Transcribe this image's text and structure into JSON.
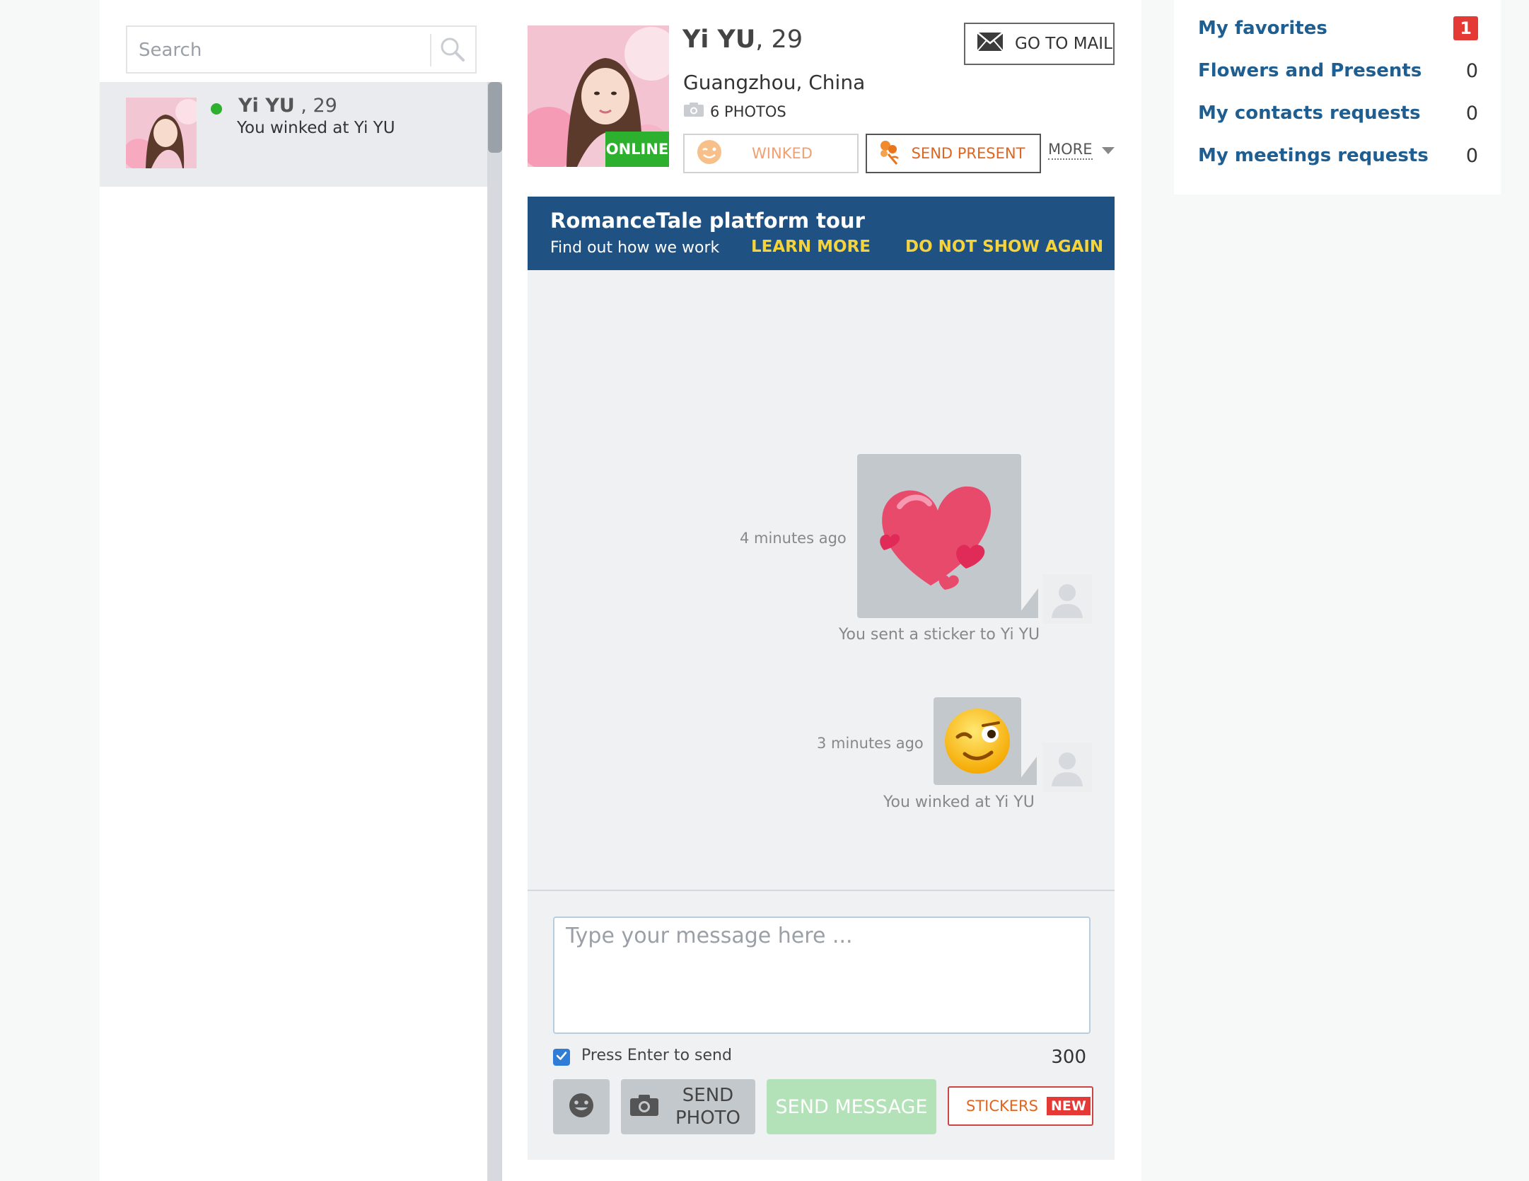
{
  "search": {
    "placeholder": "Search"
  },
  "contacts": [
    {
      "name": "Yi YU",
      "age_text": ", 29",
      "status": "You winked at Yi YU",
      "online": true
    }
  ],
  "profile": {
    "name": "Yi YU",
    "age_text": ", 29",
    "location": "Guangzhou, China",
    "photos_label": "6 PHOTOS",
    "online_badge": "ONLINE",
    "go_to_mail": "GO TO MAIL",
    "winked_label": "WINKED",
    "send_present_label": "SEND PRESENT",
    "more_label": "MORE"
  },
  "tour": {
    "title": "RomanceTale platform tour",
    "subtitle": "Find out how we work",
    "learn_more": "LEARN MORE",
    "dismiss": "DO NOT SHOW AGAIN"
  },
  "messages": [
    {
      "time": "4 minutes ago",
      "caption": "You sent a sticker to Yi YU",
      "kind": "heart-sticker"
    },
    {
      "time": "3 minutes ago",
      "caption": "You winked at Yi YU",
      "kind": "wink-emoji"
    }
  ],
  "composer": {
    "placeholder": "Type your message here ...",
    "press_enter_label": "Press Enter to send",
    "press_enter_checked": true,
    "char_count": "300",
    "send_photo_label": "SEND PHOTO",
    "send_message_label": "SEND MESSAGE",
    "stickers_label": "STICKERS",
    "stickers_badge": "NEW"
  },
  "sidebar": {
    "items": [
      {
        "label": "My favorites",
        "count": "1"
      },
      {
        "label": "Flowers and Presents",
        "count": "0"
      },
      {
        "label": "My contacts requests",
        "count": "0"
      },
      {
        "label": "My meetings requests",
        "count": "0"
      }
    ]
  },
  "colors": {
    "online_green": "#2db02d",
    "banner_blue": "#1f5282",
    "banner_link_yellow": "#f5d33a",
    "link_blue": "#1e5e91",
    "badge_red": "#e53935",
    "present_orange": "#e0651e",
    "send_message_disabled": "#b4e2b8"
  },
  "icons": [
    "search-icon",
    "mail-icon",
    "camera-icon",
    "wink-icon",
    "flower-icon",
    "chevron-down-icon",
    "smiley-icon",
    "check-icon",
    "user-placeholder-icon"
  ]
}
